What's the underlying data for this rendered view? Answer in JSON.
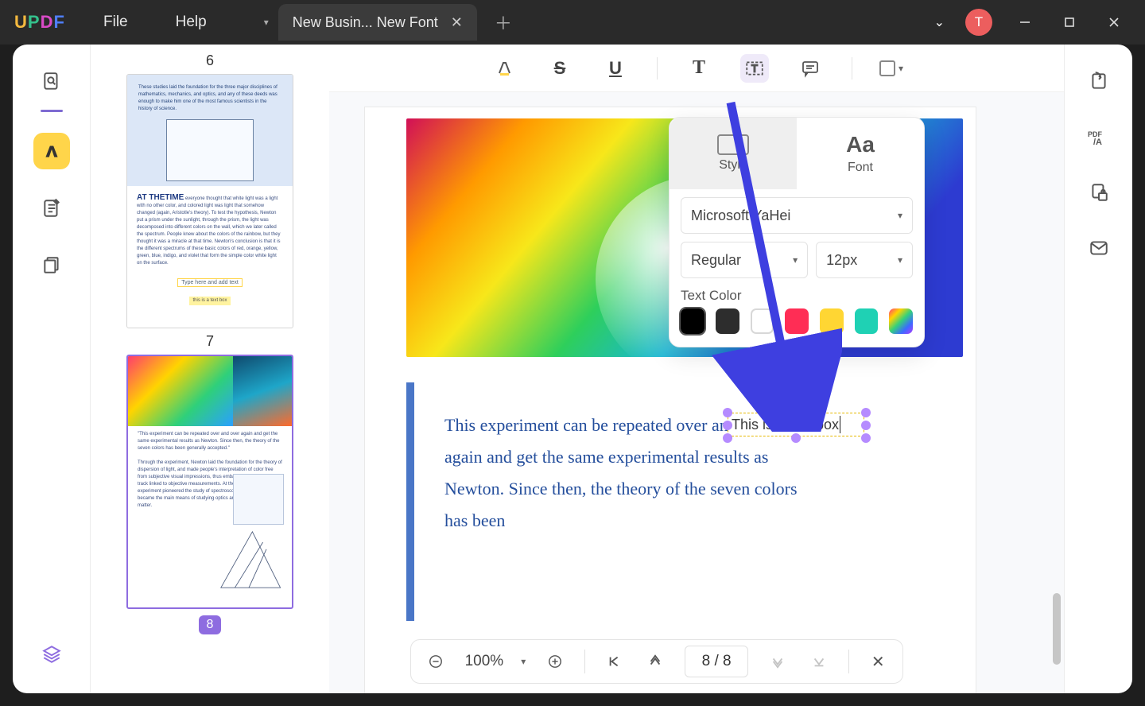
{
  "app": {
    "logo": "UPDF"
  },
  "menu": {
    "file": "File",
    "help": "Help"
  },
  "tab": {
    "title": "New Busin... New Font"
  },
  "avatar": {
    "initial": "T"
  },
  "thumbs": {
    "label6": "6",
    "label7": "7",
    "badge8": "8",
    "t6_heading": "AT THETIME",
    "t6_top_text": "These studies laid the foundation for the three major disciplines of mathematics, mechanics, and optics, and any of these deeds was enough to make him one of the most famous scientists in the history of science.",
    "t6_body_text": "everyone thought that white light was a light with no other color, and colored light was light that somehow changed (again, Aristotle's theory). To test the hypothesis, Newton put a prism under the sunlight, through the prism, the light was decomposed into different colors on the wall, which we later called the spectrum. People knew about the colors of the rainbow, but they thought it was a miracle at that time. Newton's conclusion is that it is the different spectrums of these basic colors of red, orange, yellow, green, blue, indigo, and violet that form the simple color white light on the surface.",
    "t6_caption": "Type here and add text",
    "t6_highlight": "this is a text box"
  },
  "doc": {
    "paragraph": "This experiment can be repeated over and over again and get the same experimental results as Newton. Since then, the theory of the seven colors has been",
    "textbox": "This is a text box"
  },
  "panel": {
    "tab_style": "Style",
    "tab_font": "Font",
    "font_big": "Aa",
    "font_family": "Microsoft YaHei",
    "font_weight": "Regular",
    "font_size": "12px",
    "section_color": "Text Color",
    "colors": [
      "#000000",
      "#2d2d2d",
      "#ffffff",
      "#ff2d55",
      "#ffd633",
      "#1fd1b4",
      "rainbow"
    ]
  },
  "nav": {
    "zoom": "100%",
    "page": "8 / 8"
  }
}
